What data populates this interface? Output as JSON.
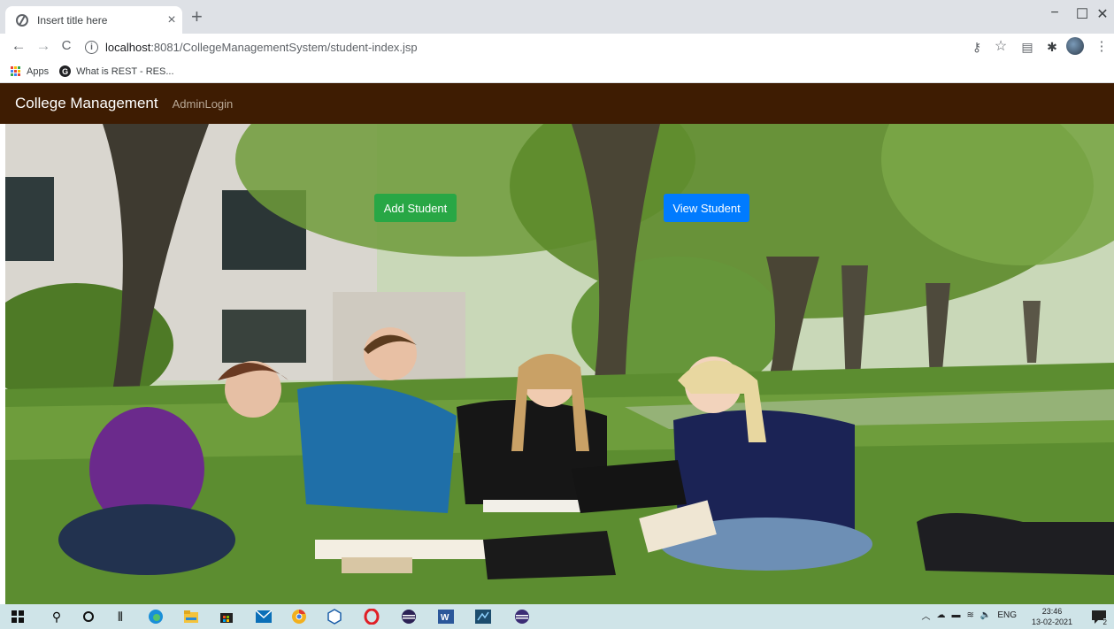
{
  "browser": {
    "tab_title": "Insert title here",
    "tab_close": "×",
    "new_tab": "+",
    "window_controls": {
      "minimize": "−",
      "maximize": "☐",
      "close": "✕"
    },
    "nav": {
      "back": "←",
      "forward": "→",
      "reload": "C"
    },
    "url_host": "localhost",
    "url_rest": ":8081/CollegeManagementSystem/student-index.jsp",
    "bookmarks": [
      {
        "label": "Apps",
        "icon": "apps-grid-icon"
      },
      {
        "label": "What is REST - RES...",
        "icon": "g-favicon-icon"
      }
    ],
    "toolbar_icons": [
      "key-icon",
      "star-icon",
      "reading-list-icon",
      "extensions-icon",
      "profile-avatar",
      "menu-icon"
    ]
  },
  "page": {
    "brand": "College Management",
    "nav_link": "AdminLogin",
    "hero_image": "students-studying-on-campus-lawn",
    "buttons": {
      "add_student": "Add Student",
      "view_student": "View Student"
    },
    "colors": {
      "navbar": "#3e1c02",
      "add_button": "#28a745",
      "view_button": "#007bff"
    }
  },
  "taskbar": {
    "language": "ENG",
    "time": "23:46",
    "date": "13-02-2021",
    "notification_count": "2",
    "icons": [
      "windows-start-icon",
      "search-icon",
      "cortana-icon",
      "task-view-icon",
      "edge-icon",
      "file-explorer-icon",
      "store-icon",
      "mail-icon",
      "chrome-icon",
      "virtualbox-icon",
      "opera-icon",
      "eclipse-icon",
      "word-icon",
      "app-icon",
      "eclipse-ee-icon"
    ]
  }
}
